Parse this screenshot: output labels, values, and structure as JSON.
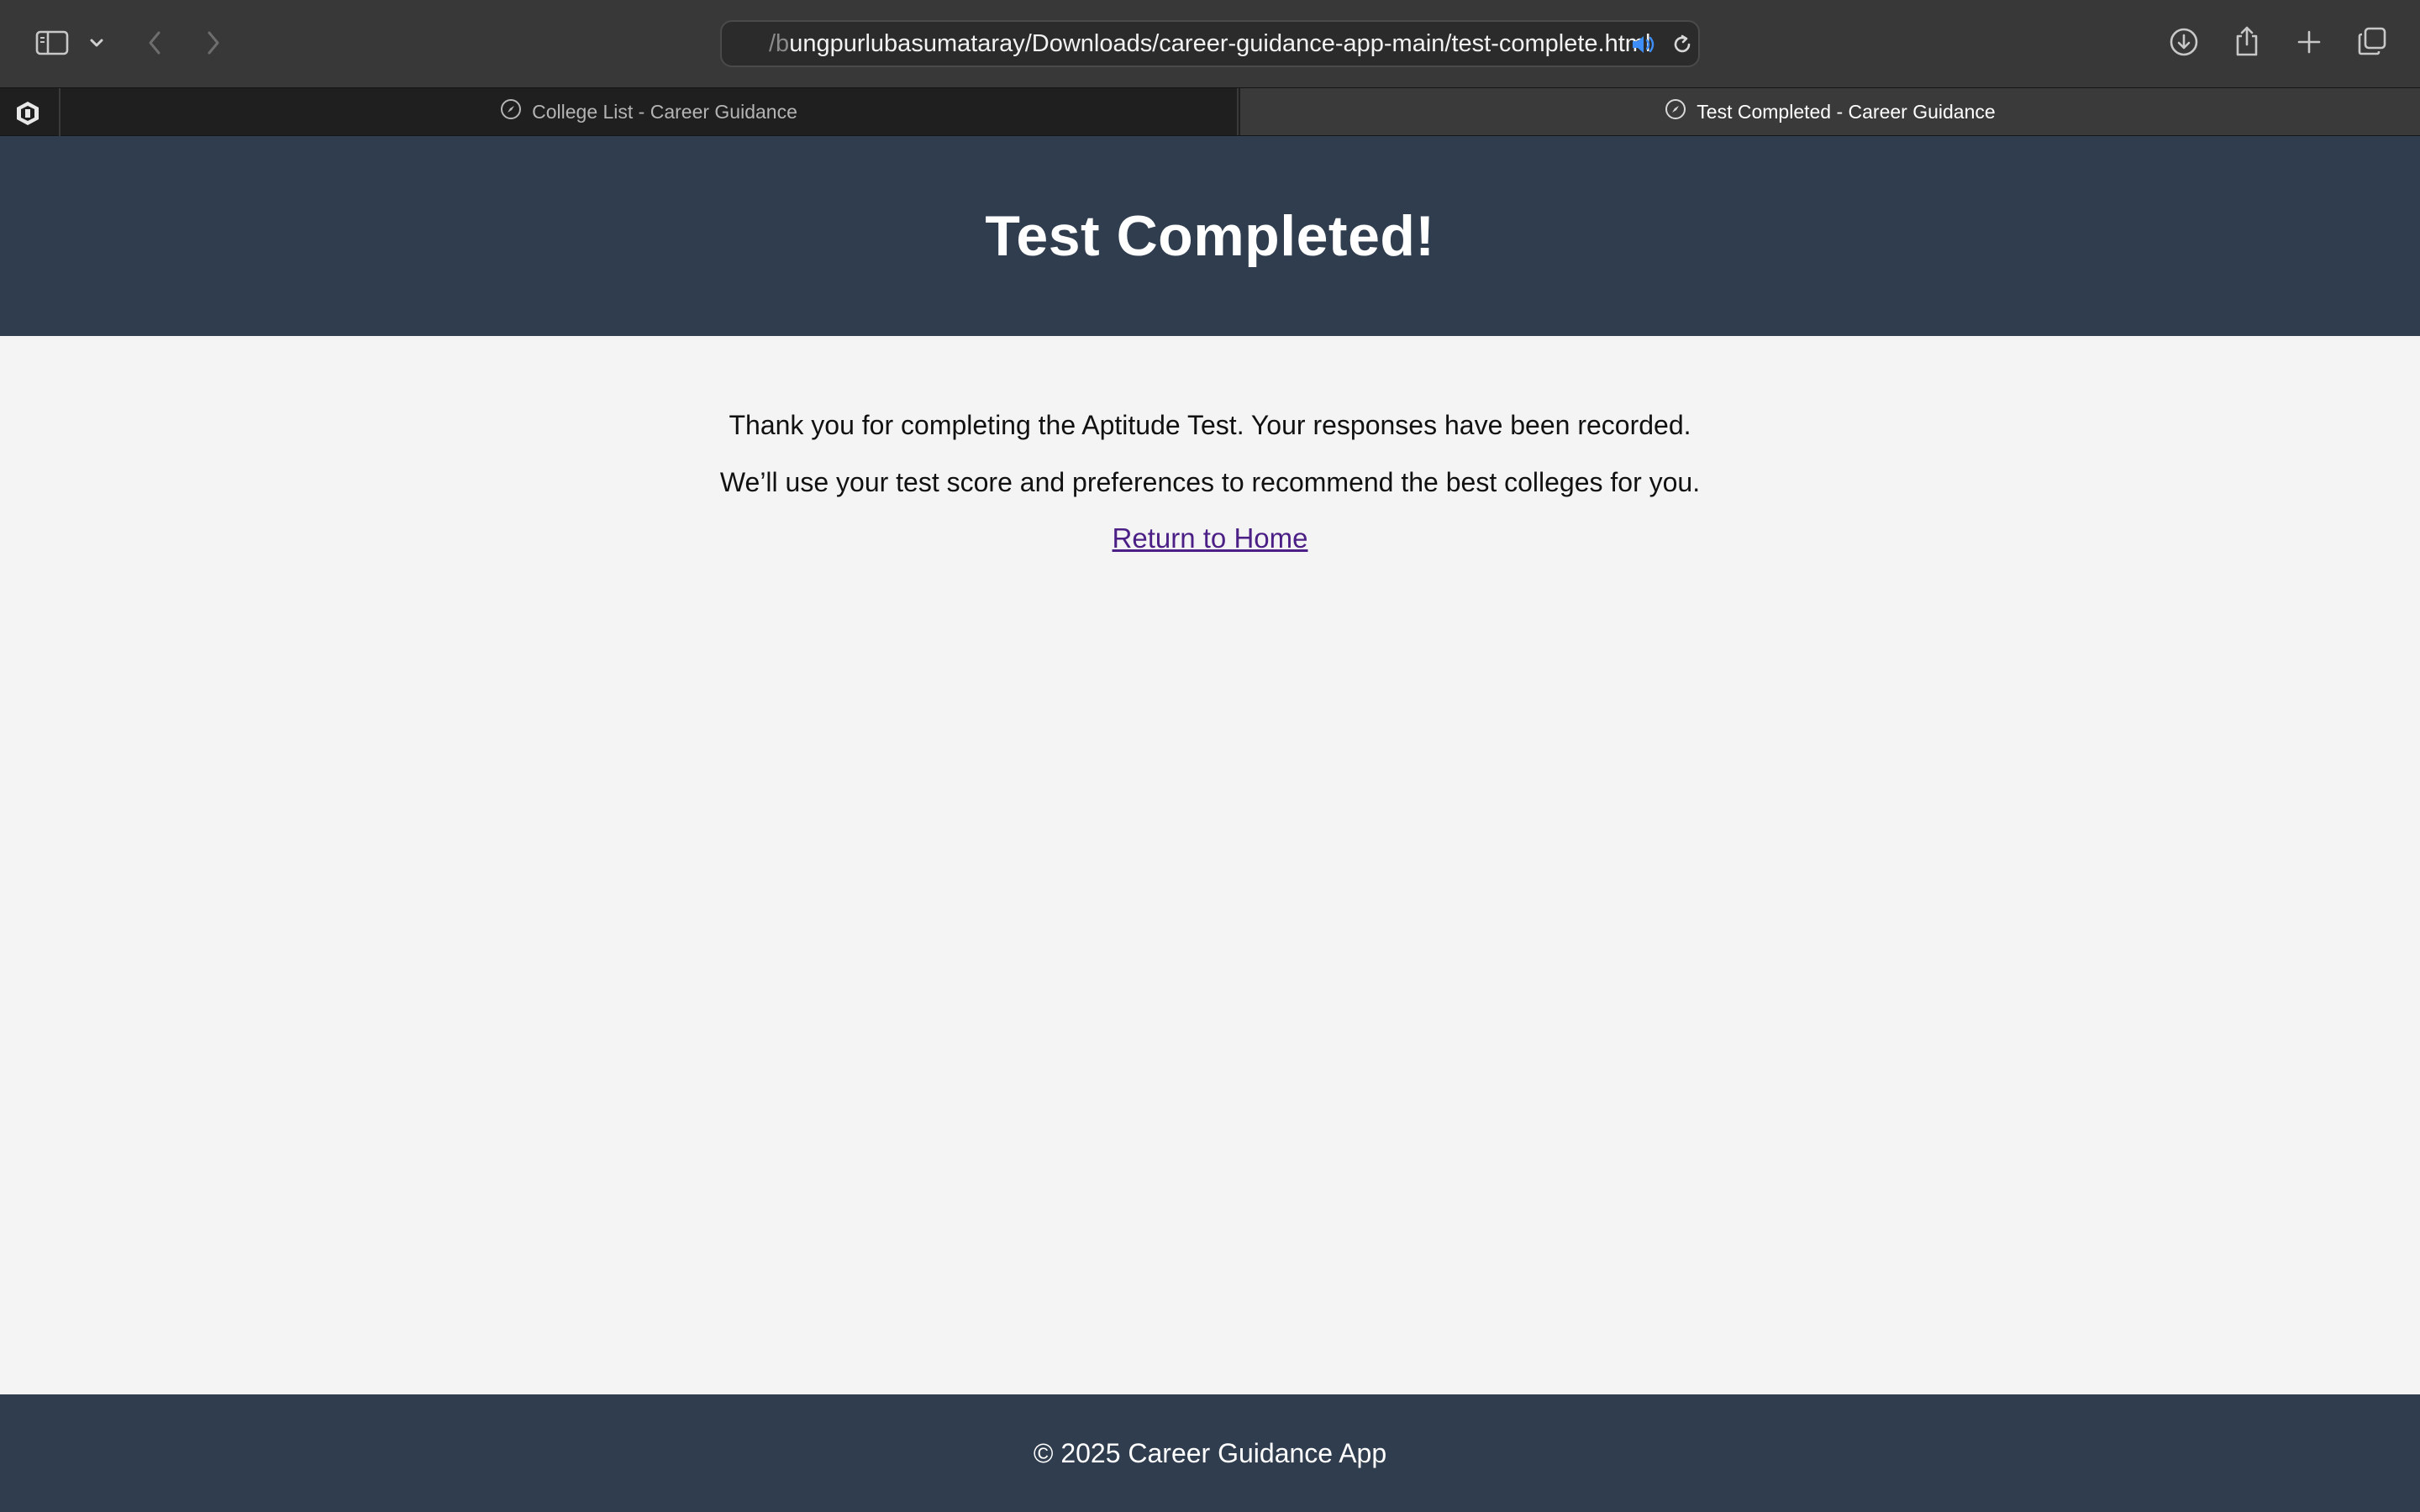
{
  "browser": {
    "address": {
      "prefix_dim": "/b",
      "url": "ungpurlubasumataray/Downloads/career-guidance-app-main/test-complete.html"
    },
    "tabs": [
      {
        "label": "College List - Career Guidance",
        "active": false
      },
      {
        "label": "Test Completed - Career Guidance",
        "active": true
      }
    ],
    "icons": {
      "sidebar": "sidebar-icon",
      "chevron": "chevron-down-icon",
      "back": "back-arrow-icon",
      "forward": "forward-arrow-icon",
      "audio": "speaker-icon",
      "reload": "reload-icon",
      "download": "download-icon",
      "share": "share-icon",
      "new_tab": "plus-icon",
      "tab_overview": "tab-overview-icon",
      "extension": "shield-extension-icon",
      "tab_favicon": "compass-icon"
    },
    "colors": {
      "toolbar": "#383838",
      "tabbar": "#1f1f1f",
      "active_tab": "#3a3a3a",
      "audio_accent": "#3d8ef7"
    }
  },
  "page": {
    "header": {
      "title": "Test Completed!"
    },
    "content": {
      "line1": "Thank you for completing the Aptitude Test. Your responses have been recorded.",
      "line2": "We’ll use your test score and preferences to recommend the best colleges for you.",
      "link": "Return to Home"
    },
    "footer": {
      "text": "© 2025 Career Guidance App"
    },
    "colors": {
      "header_bg": "#2f3d4f",
      "body_bg": "#f4f4f4",
      "link": "#4b1f86"
    }
  }
}
